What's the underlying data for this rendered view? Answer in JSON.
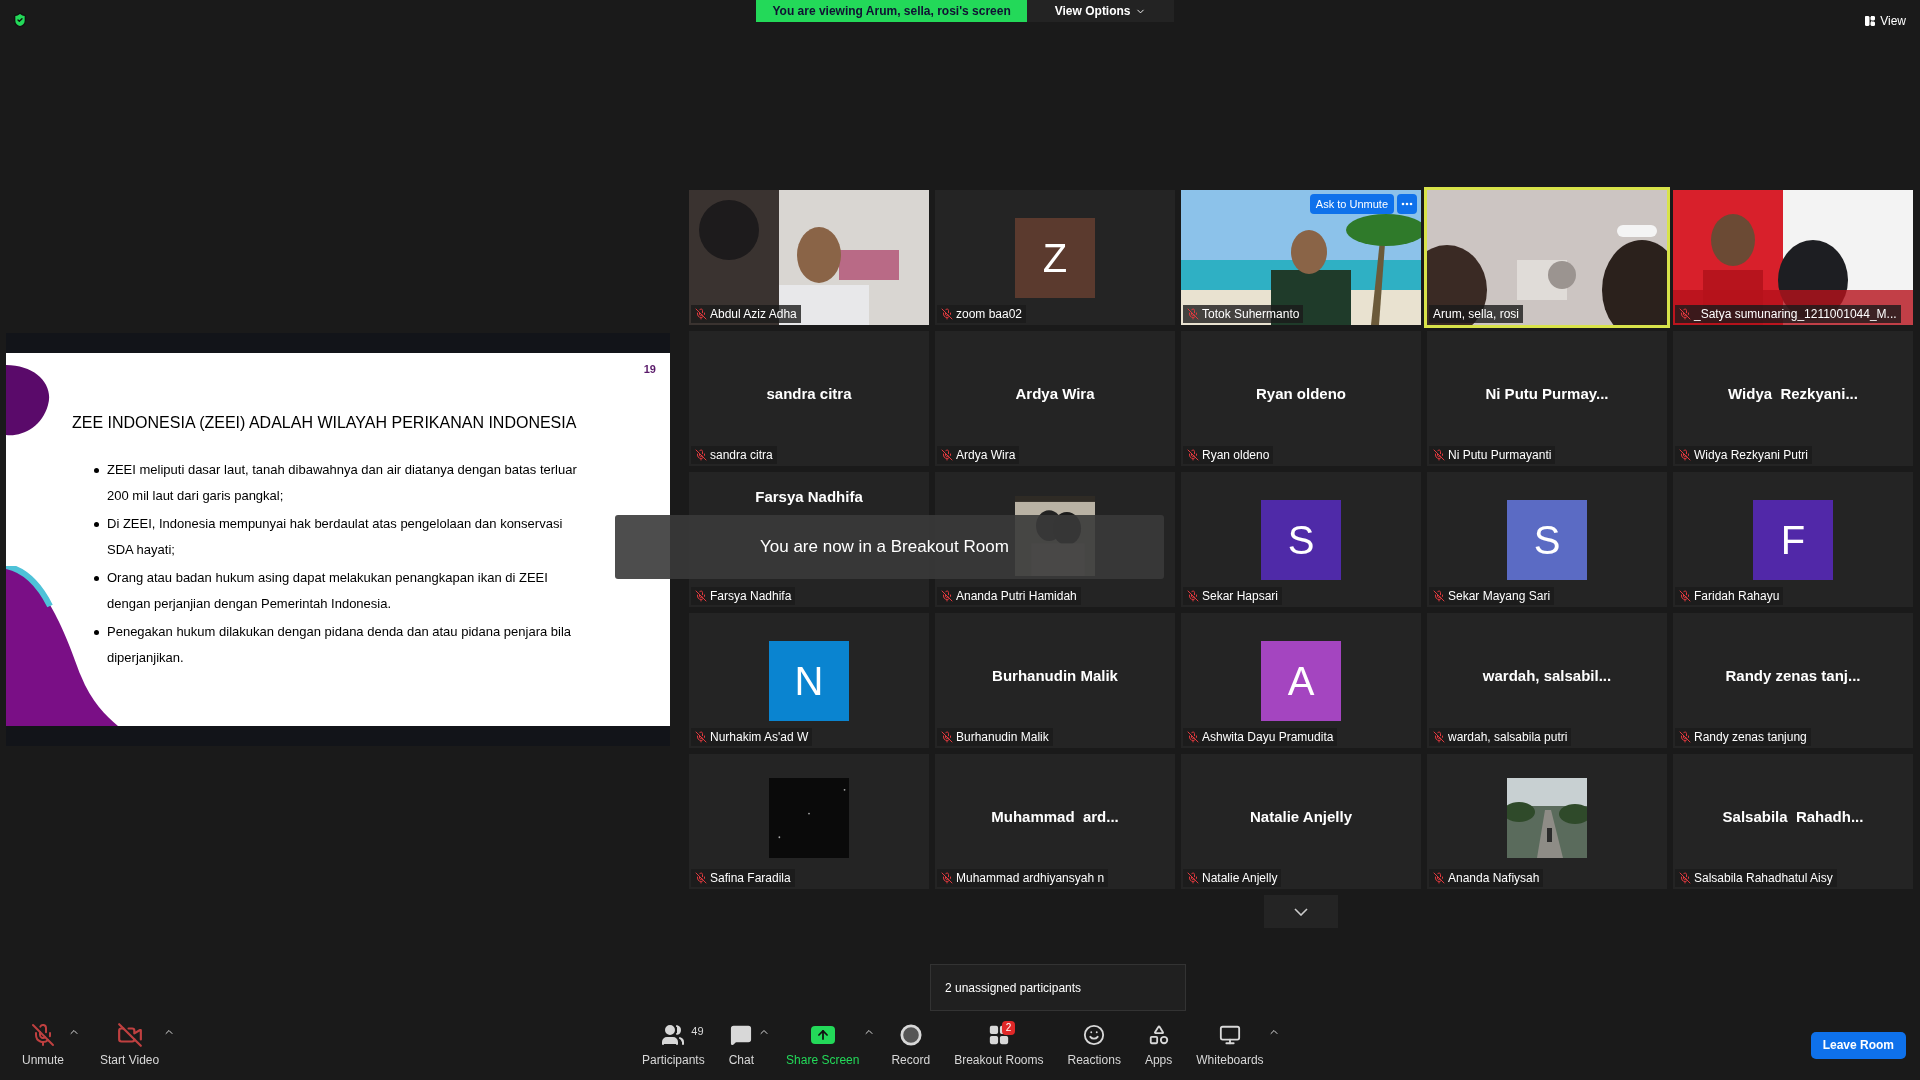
{
  "top_bar": {
    "banner": "You are viewing Arum, sella, rosi's screen",
    "view_options": "View Options",
    "view": "View"
  },
  "slide": {
    "page": "19",
    "title": "ZEE INDONESIA (ZEEI) ADALAH WILAYAH PERIKANAN INDONESIA",
    "bullets": [
      "ZEEI meliputi dasar laut, tanah dibawahnya dan air diatanya dengan batas terluar 200 mil laut dari garis pangkal;",
      "Di ZEEI, Indonesia mempunyai hak berdaulat atas pengelolaan dan konservasi SDA hayati;",
      "Orang atau badan hukum asing dapat melakukan penangkapan ikan di ZEEI dengan perjanjian dengan Pemerintah Indonesia.",
      "Penegakan hukum dilakukan dengan pidana denda dan atau pidana penjara bila diperjanjikan."
    ]
  },
  "tiles": [
    {
      "kind": "video",
      "name": "Abdul Aziz Adha",
      "muted": true,
      "active": false
    },
    {
      "kind": "avatar",
      "letter": "Z",
      "color": "#5b3a2e",
      "name": "zoom baa02",
      "muted": true,
      "active": false
    },
    {
      "kind": "video",
      "name": "Totok Suhermanto",
      "muted": true,
      "active": false,
      "ask_button": "Ask to Unmute"
    },
    {
      "kind": "video",
      "name": "Arum, sella, rosi",
      "muted": false,
      "active": true
    },
    {
      "kind": "video",
      "name": "_Satya sumunaring_1211001044_M...",
      "muted": true,
      "active": false
    },
    {
      "kind": "name",
      "display": "sandra citra",
      "name": "sandra citra",
      "muted": true,
      "active": false
    },
    {
      "kind": "name",
      "display": "Ardya Wira",
      "name": "Ardya Wira",
      "muted": true,
      "active": false
    },
    {
      "kind": "name",
      "display": "Ryan oldeno",
      "name": "Ryan oldeno",
      "muted": true,
      "active": false
    },
    {
      "kind": "name",
      "display": "Ni Putu Purmay...",
      "name": "Ni Putu Purmayanti",
      "muted": true,
      "active": false
    },
    {
      "kind": "name",
      "display": "Widya  Rezkyani...",
      "name": "Widya Rezkyani Putri",
      "muted": true,
      "active": false
    },
    {
      "kind": "name",
      "display": "Farsya Nadhifa",
      "name": "Farsya Nadhifa",
      "muted": true,
      "active": false
    },
    {
      "kind": "thumb",
      "name": "Ananda Putri Hamidah",
      "muted": true,
      "active": false
    },
    {
      "kind": "avatar",
      "letter": "S",
      "color": "#4f2aa8",
      "name": "Sekar Hapsari",
      "muted": true,
      "active": false
    },
    {
      "kind": "avatar",
      "letter": "S",
      "color": "#5b6bc4",
      "name": "Sekar Mayang Sari",
      "muted": true,
      "active": false
    },
    {
      "kind": "avatar",
      "letter": "F",
      "color": "#5128a8",
      "name": "Faridah Rahayu",
      "muted": true,
      "active": false
    },
    {
      "kind": "avatar",
      "letter": "N",
      "color": "#0a84d0",
      "name": "Nurhakim As'ad W",
      "muted": true,
      "active": false
    },
    {
      "kind": "name",
      "display": "Burhanudin Malik",
      "name": "Burhanudin Malik",
      "muted": true,
      "active": false
    },
    {
      "kind": "avatar",
      "letter": "A",
      "color": "#a445c0",
      "name": "Ashwita Dayu Pramudita",
      "muted": true,
      "active": false
    },
    {
      "kind": "name",
      "display": "wardah, salsabil...",
      "name": "wardah, salsabila putri",
      "muted": true,
      "active": false
    },
    {
      "kind": "name",
      "display": "Randy zenas tanj...",
      "name": "Randy zenas tanjung",
      "muted": true,
      "active": false
    },
    {
      "kind": "thumb",
      "name": "Safina Faradila",
      "muted": true,
      "active": false
    },
    {
      "kind": "name",
      "display": "Muhammad  ard...",
      "name": "Muhammad ardhiyansyah n",
      "muted": true,
      "active": false
    },
    {
      "kind": "name",
      "display": "Natalie Anjelly",
      "name": "Natalie Anjelly",
      "muted": true,
      "active": false
    },
    {
      "kind": "thumb",
      "name": "Ananda Nafiysah",
      "muted": true,
      "active": false
    },
    {
      "kind": "name",
      "display": "Salsabila  Rahadh...",
      "name": "Salsabila Rahadhatul Aisy",
      "muted": true,
      "active": false
    }
  ],
  "toast": "You are now in a Breakout Room",
  "tooltip": "2 unassigned participants",
  "toolbar": {
    "left": [
      {
        "kind": "mic",
        "label": "Unmute",
        "off": true,
        "caret": true
      },
      {
        "kind": "video",
        "label": "Start Video",
        "off": true,
        "caret": true
      }
    ],
    "center": [
      {
        "kind": "participants",
        "label": "Participants",
        "count": "49"
      },
      {
        "kind": "chat",
        "label": "Chat",
        "caret": true
      },
      {
        "kind": "share",
        "label": "Share Screen",
        "caret": true
      },
      {
        "kind": "record",
        "label": "Record"
      },
      {
        "kind": "breakout",
        "label": "Breakout Rooms",
        "badge": "2"
      },
      {
        "kind": "reactions",
        "label": "Reactions"
      },
      {
        "kind": "apps",
        "label": "Apps"
      },
      {
        "kind": "whiteboards",
        "label": "Whiteboards",
        "caret": true
      }
    ],
    "leave": "Leave Room"
  }
}
